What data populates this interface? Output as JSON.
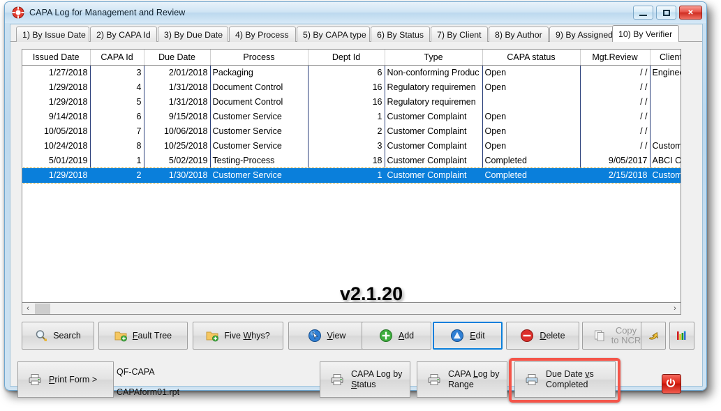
{
  "window": {
    "title": "CAPA Log for Management and Review",
    "icon": "lifebuoy-icon",
    "minimize_label": "Minimize",
    "maximize_label": "Maximize",
    "close_label": "Close"
  },
  "tabs": [
    {
      "label": "1) By Issue Date",
      "accel": "1",
      "active": false
    },
    {
      "label": "2) By CAPA Id",
      "accel": "2",
      "active": false
    },
    {
      "label": "3) By Due Date",
      "accel": "3",
      "active": false
    },
    {
      "label": "4) By Process",
      "accel": "4",
      "active": false
    },
    {
      "label": "5) By CAPA type",
      "accel": "5",
      "active": false
    },
    {
      "label": "6) By Status",
      "accel": "6",
      "active": false
    },
    {
      "label": "7) By Client",
      "accel": "7",
      "active": false
    },
    {
      "label": "8) By Author",
      "accel": "8",
      "active": false
    },
    {
      "label": "9) By Assigned",
      "accel": "9",
      "active": false
    },
    {
      "label": "10) By Verifier",
      "accel": "V",
      "active": true
    }
  ],
  "grid": {
    "columns": [
      "Issued Date",
      "CAPA Id",
      "Due Date",
      "Process",
      "Dept Id",
      "Type",
      "CAPA status",
      "Mgt.Review",
      "Client"
    ],
    "rows": [
      {
        "issued_date": "1/27/2018",
        "capa_id": "3",
        "due_date": "2/01/2018",
        "process": "Packaging",
        "dept_id": "6",
        "type": "Non-conforming Produc",
        "capa_status": "Open",
        "mgt_review": "/ /",
        "client": "Enginee",
        "selected": false
      },
      {
        "issued_date": "1/29/2018",
        "capa_id": "4",
        "due_date": "1/31/2018",
        "process": "Document Control",
        "dept_id": "16",
        "type": "Regulatory requiremen",
        "capa_status": "Open",
        "mgt_review": "/ /",
        "client": "",
        "selected": false
      },
      {
        "issued_date": "1/29/2018",
        "capa_id": "5",
        "due_date": "1/31/2018",
        "process": "Document Control",
        "dept_id": "16",
        "type": "Regulatory requiremen",
        "capa_status": "",
        "mgt_review": "/ /",
        "client": "",
        "selected": false
      },
      {
        "issued_date": "9/14/2018",
        "capa_id": "6",
        "due_date": "9/15/2018",
        "process": "Customer Service",
        "dept_id": "1",
        "type": "Customer Complaint",
        "capa_status": "Open",
        "mgt_review": "/ /",
        "client": "",
        "selected": false
      },
      {
        "issued_date": "10/05/2018",
        "capa_id": "7",
        "due_date": "10/06/2018",
        "process": "Customer Service",
        "dept_id": "2",
        "type": "Customer Complaint",
        "capa_status": "Open",
        "mgt_review": "/ /",
        "client": "",
        "selected": false
      },
      {
        "issued_date": "10/24/2018",
        "capa_id": "8",
        "due_date": "10/25/2018",
        "process": "Customer Service",
        "dept_id": "3",
        "type": "Customer Complaint",
        "capa_status": "Open",
        "mgt_review": "/ /",
        "client": "Custom",
        "selected": false
      },
      {
        "issued_date": "5/01/2019",
        "capa_id": "1",
        "due_date": "5/02/2019",
        "process": "Testing-Process",
        "dept_id": "18",
        "type": "Customer Complaint",
        "capa_status": "Completed",
        "mgt_review": "9/05/2017",
        "client": "ABCI CO",
        "selected": false
      },
      {
        "issued_date": "1/29/2018",
        "capa_id": "2",
        "due_date": "1/30/2018",
        "process": "Customer Service",
        "dept_id": "1",
        "type": "Customer Complaint",
        "capa_status": "Completed",
        "mgt_review": "2/15/2018",
        "client": "Custom",
        "selected": true
      }
    ]
  },
  "watermark": "v2.1.20",
  "scrollbar": {
    "left_arrow": "‹",
    "right_arrow": "›"
  },
  "toolbar": [
    {
      "label": "Search",
      "icon": "magnifier-icon",
      "focused": false,
      "disabled": false
    },
    {
      "label": "Fault Tree",
      "icon": "folder-add-icon",
      "focused": false,
      "disabled": false
    },
    {
      "label": "Five Whys?",
      "icon": "folder-add-icon",
      "focused": false,
      "disabled": false
    },
    {
      "label": "View",
      "icon": "cursor-globe-icon",
      "focused": false,
      "disabled": false
    },
    {
      "label": "Add",
      "icon": "green-plus-icon",
      "focused": false,
      "disabled": false
    },
    {
      "label": "Edit",
      "icon": "blue-triangle-icon",
      "focused": true,
      "disabled": false
    },
    {
      "label": "Delete",
      "icon": "red-minus-icon",
      "focused": false,
      "disabled": false
    },
    {
      "label": "Copy to NCR",
      "line1": "Copy",
      "line2": "to NCR",
      "icon": "copy-pages-icon",
      "focused": false,
      "disabled": true
    },
    {
      "label": "",
      "icon": "yellow-arrow-icon",
      "focused": false,
      "disabled": false
    },
    {
      "label": "",
      "icon": "bar-chart-icon",
      "focused": false,
      "disabled": false
    }
  ],
  "bottom": {
    "print_form": {
      "label": "Print Form >",
      "icon": "printer-icon"
    },
    "report_name": "QF-CAPA",
    "report_file": "CAPAform01.rpt",
    "capa_log_status": {
      "line1": "CAPA Log by",
      "line2": "Status",
      "icon": "printer-icon"
    },
    "capa_log_range": {
      "line1": "CAPA Log by",
      "line2": "Range",
      "icon": "printer-icon"
    },
    "due_date_vs_completed": {
      "line1": "Due Date vs",
      "line2": "Completed",
      "icon": "printer-icon",
      "highlighted": true
    },
    "power": {
      "label": "Exit",
      "icon": "power-icon"
    }
  },
  "colors": {
    "selection": "#0a7fdb",
    "highlight_box": "#f4554a",
    "title_bar": "#cfe4f4",
    "grid_divider": "#2a3f7a"
  }
}
